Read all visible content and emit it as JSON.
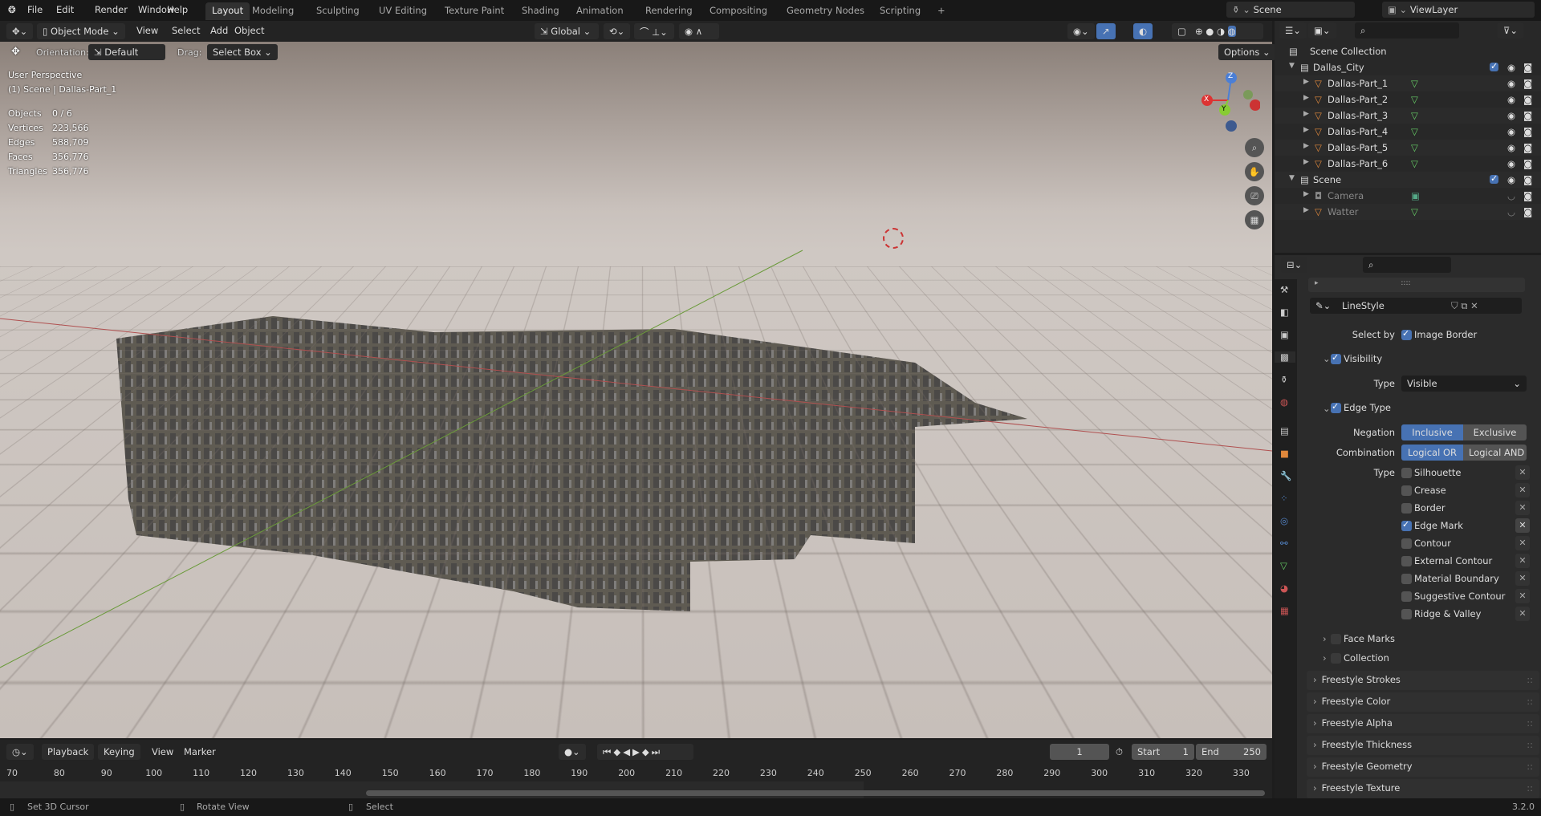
{
  "topbar": {
    "menus": [
      "File",
      "Edit",
      "Render",
      "Window",
      "Help"
    ],
    "workspaces": [
      "Layout",
      "Modeling",
      "Sculpting",
      "UV Editing",
      "Texture Paint",
      "Shading",
      "Animation",
      "Rendering",
      "Compositing",
      "Geometry Nodes",
      "Scripting",
      "+"
    ],
    "active_workspace": "Layout",
    "scene": "Scene",
    "view_layer": "ViewLayer"
  },
  "header": {
    "mode": "Object Mode",
    "menus": [
      "View",
      "Select",
      "Add",
      "Object"
    ],
    "transform": "Global"
  },
  "toolheader": {
    "orientation_label": "Orientation:",
    "orientation": "Default",
    "drag_label": "Drag:",
    "drag": "Select Box",
    "options": "Options"
  },
  "overlay": {
    "view": "User Perspective",
    "context": "(1) Scene | Dallas-Part_1",
    "stats": [
      {
        "k": "Objects",
        "v": "0 / 6"
      },
      {
        "k": "Vertices",
        "v": "223,566"
      },
      {
        "k": "Edges",
        "v": "588,709"
      },
      {
        "k": "Faces",
        "v": "356,776"
      },
      {
        "k": "Triangles",
        "v": "356,776"
      }
    ],
    "gizmo": {
      "x": "X",
      "y": "Y",
      "z": "Z"
    }
  },
  "outliner": {
    "root": "Scene Collection",
    "rows": [
      {
        "label": "Dallas_City",
        "level": 1,
        "type": "collection"
      },
      {
        "label": "Dallas-Part_1",
        "level": 2,
        "type": "mesh"
      },
      {
        "label": "Dallas-Part_2",
        "level": 2,
        "type": "mesh"
      },
      {
        "label": "Dallas-Part_3",
        "level": 2,
        "type": "mesh"
      },
      {
        "label": "Dallas-Part_4",
        "level": 2,
        "type": "mesh"
      },
      {
        "label": "Dallas-Part_5",
        "level": 2,
        "type": "mesh"
      },
      {
        "label": "Dallas-Part_6",
        "level": 2,
        "type": "mesh"
      },
      {
        "label": "Scene",
        "level": 1,
        "type": "collection"
      },
      {
        "label": "Camera",
        "level": 2,
        "type": "camera",
        "dim": true
      },
      {
        "label": "Watter",
        "level": 2,
        "type": "mesh",
        "dim": true
      }
    ]
  },
  "props": {
    "linestyle": "LineStyle",
    "select_by_label": "Select by",
    "image_border": "Image Border",
    "visibility": "Visibility",
    "type_label": "Type",
    "visibility_type": "Visible",
    "edge_type": "Edge Type",
    "negation_label": "Negation",
    "inclusive": "Inclusive",
    "exclusive": "Exclusive",
    "combination_label": "Combination",
    "logical_or": "Logical OR",
    "logical_and": "Logical AND",
    "edge_types": [
      {
        "label": "Silhouette",
        "on": false
      },
      {
        "label": "Crease",
        "on": false
      },
      {
        "label": "Border",
        "on": false
      },
      {
        "label": "Edge Mark",
        "on": true
      },
      {
        "label": "Contour",
        "on": false
      },
      {
        "label": "External Contour",
        "on": false
      },
      {
        "label": "Material Boundary",
        "on": false
      },
      {
        "label": "Suggestive Contour",
        "on": false
      },
      {
        "label": "Ridge & Valley",
        "on": false
      }
    ],
    "subpanels": [
      "Face Marks",
      "Collection"
    ],
    "panels": [
      "Freestyle Strokes",
      "Freestyle Color",
      "Freestyle Alpha",
      "Freestyle Thickness",
      "Freestyle Geometry",
      "Freestyle Texture"
    ]
  },
  "timeline": {
    "menus": [
      "Playback",
      "Keying",
      "View",
      "Marker"
    ],
    "current_frame": "1",
    "start_label": "Start",
    "start": "1",
    "end_label": "End",
    "end": "250",
    "ticks": [
      "70",
      "80",
      "90",
      "100",
      "110",
      "120",
      "130",
      "140",
      "150",
      "160",
      "170",
      "180",
      "190",
      "200",
      "210",
      "220",
      "230",
      "240",
      "250",
      "260",
      "270",
      "280",
      "290",
      "300",
      "310",
      "320",
      "330"
    ]
  },
  "status": {
    "left": "Set 3D Cursor",
    "middle": "Rotate View",
    "right": "Select",
    "version": "3.2.0"
  }
}
